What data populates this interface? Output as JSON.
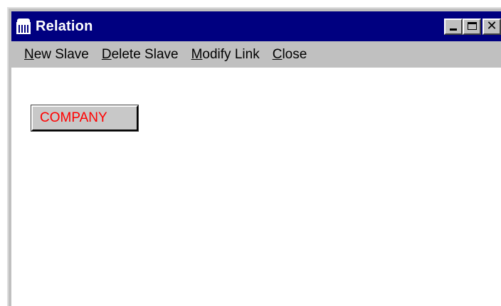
{
  "window": {
    "title": "Relation",
    "icon": "calculator-icon"
  },
  "caption_buttons": {
    "minimize_icon": "minimize-icon",
    "maximize_icon": "maximize-icon",
    "close_glyph": "✕"
  },
  "menu": {
    "items": [
      {
        "accel": "N",
        "rest": "ew Slave"
      },
      {
        "accel": "D",
        "rest": "elete Slave"
      },
      {
        "accel": "M",
        "rest": "odify Link"
      },
      {
        "accel": "C",
        "rest": "lose"
      }
    ]
  },
  "canvas": {
    "nodes": [
      {
        "label": "COMPANY",
        "color": "#ff0000"
      }
    ]
  },
  "colors": {
    "titlebar": "#000080",
    "chrome": "#c0c0c0",
    "node_text": "#ff0000"
  }
}
